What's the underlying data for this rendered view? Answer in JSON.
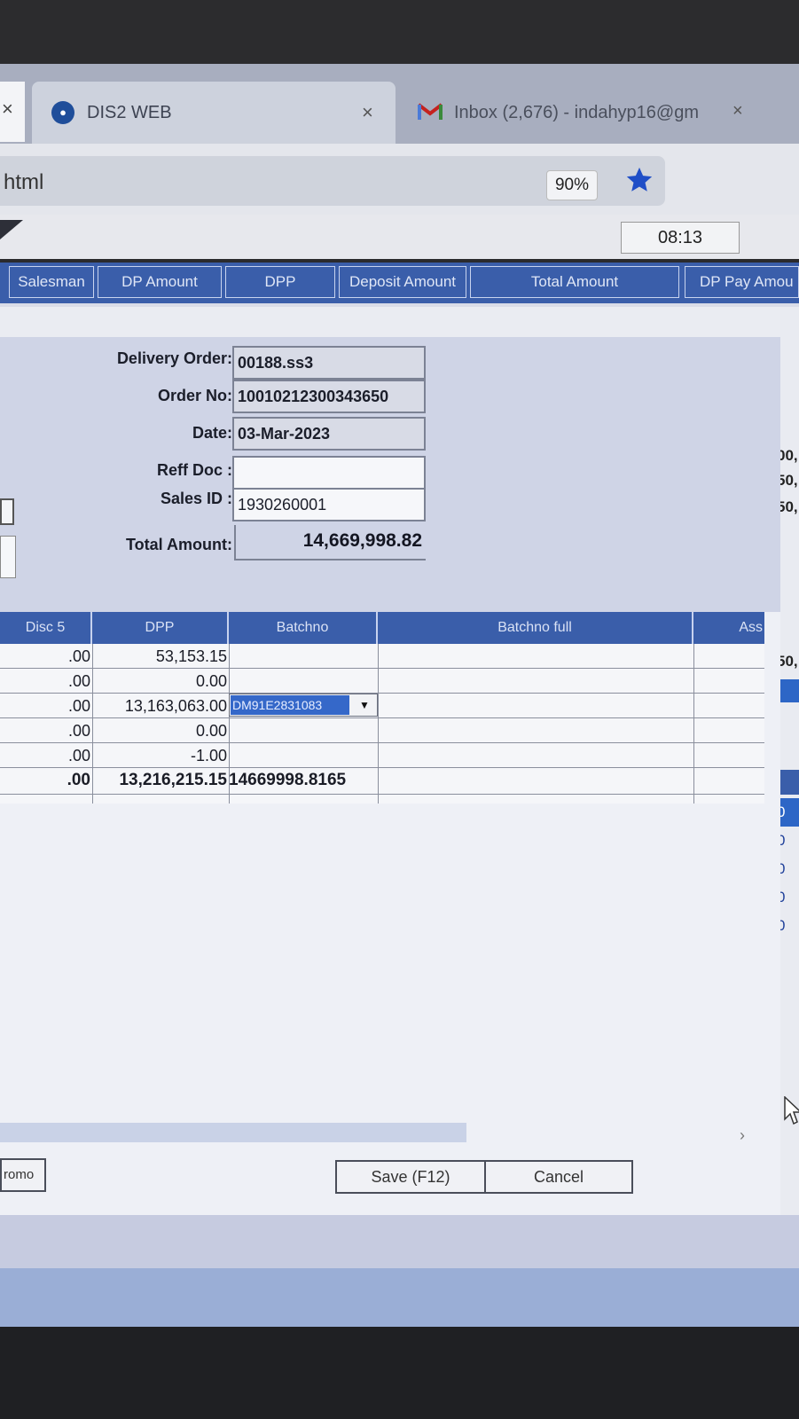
{
  "browser": {
    "tabs": [
      {
        "label": "DIS2 WEB",
        "close": "×"
      },
      {
        "label": "Inbox (2,676) - indahyp16@gm",
        "close": "×"
      }
    ],
    "left_tab_close": "×",
    "url_text": "html",
    "zoom": "90%",
    "accent": "#1f4ec7"
  },
  "app": {
    "clock": "08:13",
    "list_columns": [
      "Salesman",
      "DP Amount",
      "DPP",
      "Deposit Amount",
      "Total Amount",
      "DP Pay Amou"
    ],
    "right_edge_values": [
      "00,",
      "50,",
      "50,",
      "50,"
    ],
    "right_column_values": [
      "0",
      "0",
      "0",
      "0",
      "0"
    ]
  },
  "form": {
    "delivery_order_label": "Delivery Order:",
    "delivery_order": "00188.ss3",
    "order_no_label": "Order No:",
    "order_no": "10010212300343650",
    "date_label": "Date:",
    "date": "03-Mar-2023",
    "reff_doc_label": "Reff Doc :",
    "reff_doc": "",
    "sales_id_label": "Sales ID :",
    "sales_id": "1930260001",
    "total_amount_label": "Total Amount:",
    "total_amount": "14,669,998.82"
  },
  "items": {
    "columns": [
      "Disc 5",
      "DPP",
      "Batchno",
      "Batchno full",
      "Ass"
    ],
    "rows": [
      {
        "disc5": ".00",
        "dpp": "53,153.15",
        "batchno": ""
      },
      {
        "disc5": ".00",
        "dpp": "0.00",
        "batchno": ""
      },
      {
        "disc5": ".00",
        "dpp": "13,163,063.00",
        "batchno": "DM91E2831083"
      },
      {
        "disc5": ".00",
        "dpp": "0.00",
        "batchno": ""
      },
      {
        "disc5": ".00",
        "dpp": "-1.00",
        "batchno": ""
      }
    ],
    "total": {
      "disc5": ".00",
      "dpp": "13,216,215.15",
      "batchno": "14669998.8165"
    }
  },
  "buttons": {
    "promo": "romo",
    "save": "Save (F12)",
    "cancel": "Cancel"
  }
}
